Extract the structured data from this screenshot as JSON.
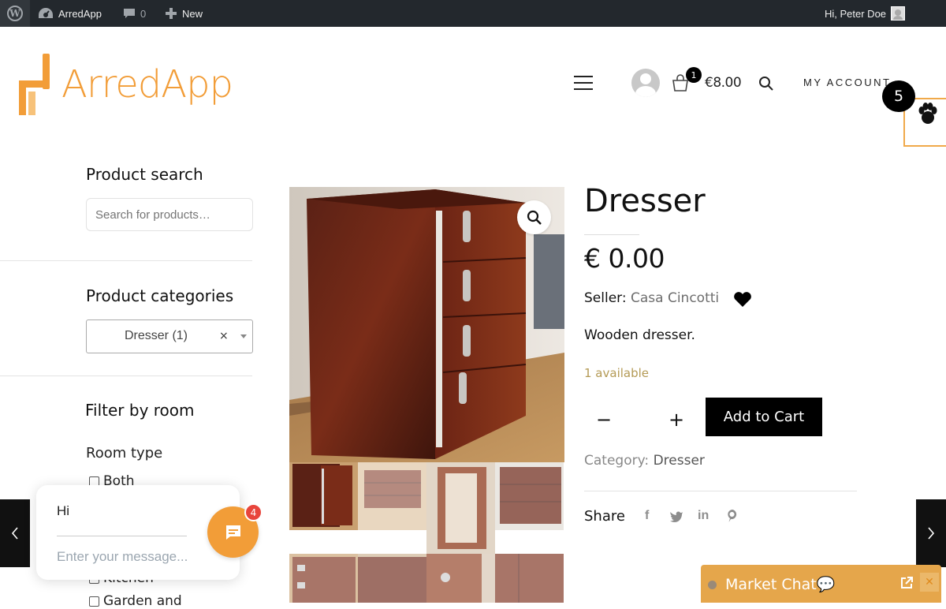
{
  "admin_bar": {
    "site_name": "ArredApp",
    "comments_count": "0",
    "new_label": "New",
    "greeting": "Hi, Peter Doe"
  },
  "header": {
    "logo_text": "ArredApp",
    "cart_count": "1",
    "cart_total": "€8.00",
    "account_label": "MY ACCOUNT",
    "notification_count": "5"
  },
  "sidebar": {
    "product_search": {
      "heading": "Product search",
      "placeholder": "Search for products…"
    },
    "product_categories": {
      "heading": "Product categories",
      "selected": "Dresser (1)",
      "clear": "×"
    },
    "filter_by_room": {
      "heading": "Filter by room",
      "room_type_label": "Room type",
      "options": [
        "Both",
        "Kitchen",
        "Garden and"
      ]
    }
  },
  "product": {
    "title": "Dresser",
    "price": "€ 0.00",
    "seller_label": "Seller:",
    "seller_name": "Casa Cincotti",
    "description": "Wooden dresser.",
    "stock": "1 available",
    "qty_minus": "−",
    "qty_plus": "+",
    "add_to_cart": "Add to Cart",
    "category_label": "Category:",
    "category_value": "Dresser",
    "share_label": "Share",
    "share_icons": [
      "facebook-icon",
      "twitter-icon",
      "linkedin-icon",
      "pinterest-icon"
    ]
  },
  "chat_widget": {
    "greeting": "Hi",
    "input_placeholder": "Enter your message...",
    "unread_count": "4"
  },
  "market_chat": {
    "title": "Market Chat💬",
    "close": "✕"
  },
  "colors": {
    "brand_orange": "#f29d38",
    "admin_bar": "#23282d",
    "market_chat": "#e5a64b",
    "stock_text": "#b49a55"
  }
}
